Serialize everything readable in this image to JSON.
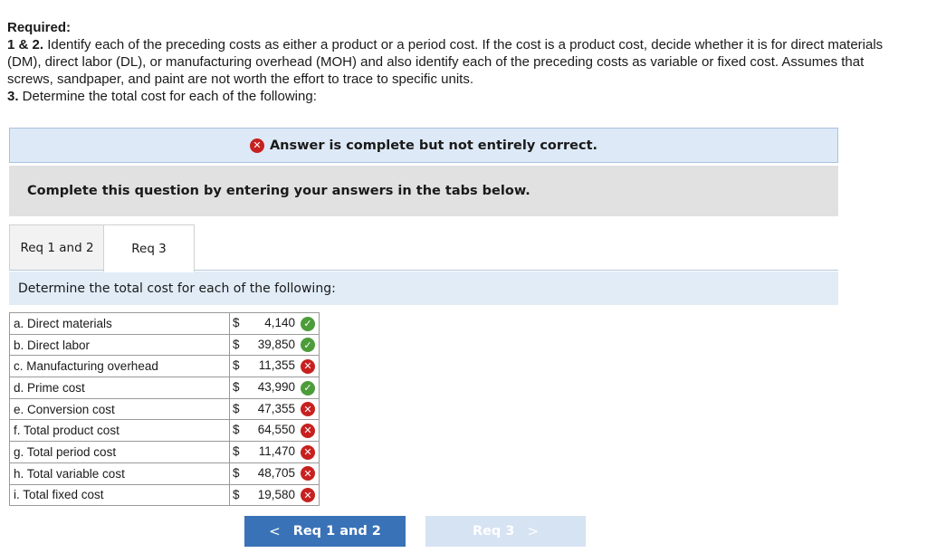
{
  "required": {
    "heading": "Required:",
    "para1_prefix": "1 & 2.",
    "para1_text": " Identify each of the preceding costs as either a product or a period cost. If the cost is a product cost, decide whether it is for direct materials (DM), direct labor (DL), or manufacturing overhead (MOH) and also identify each of the preceding costs as variable or fixed cost. Assumes that screws, sandpaper, and paint are not worth the effort to trace to specific units.",
    "para2_prefix": "3.",
    "para2_text": " Determine the total cost for each of the following:"
  },
  "banner": {
    "text": "Answer is complete but not entirely correct.",
    "icon": "x-icon",
    "color": "#c7211f"
  },
  "instruction": "Complete this question by entering your answers in the tabs below.",
  "tabs": [
    {
      "label": "Req 1 and 2",
      "active": false
    },
    {
      "label": "Req 3",
      "active": true
    }
  ],
  "section_title": "Determine the total cost for each of the following:",
  "rows": [
    {
      "label": "a. Direct materials",
      "currency": "$",
      "value": "4,140",
      "status": "correct"
    },
    {
      "label": "b. Direct labor",
      "currency": "$",
      "value": "39,850",
      "status": "correct"
    },
    {
      "label": "c. Manufacturing overhead",
      "currency": "$",
      "value": "11,355",
      "status": "incorrect"
    },
    {
      "label": "d. Prime cost",
      "currency": "$",
      "value": "43,990",
      "status": "correct"
    },
    {
      "label": "e. Conversion cost",
      "currency": "$",
      "value": "47,355",
      "status": "incorrect"
    },
    {
      "label": "f. Total product cost",
      "currency": "$",
      "value": "64,550",
      "status": "incorrect"
    },
    {
      "label": "g. Total period cost",
      "currency": "$",
      "value": "11,470",
      "status": "incorrect"
    },
    {
      "label": "h. Total variable cost",
      "currency": "$",
      "value": "48,705",
      "status": "incorrect"
    },
    {
      "label": "i. Total fixed cost",
      "currency": "$",
      "value": "19,580",
      "status": "incorrect"
    }
  ],
  "nav": {
    "prev_label": "Req 1 and 2",
    "prev_arrow": "<",
    "next_label": "Req 3",
    "next_arrow": ">"
  },
  "colors": {
    "accent": "#3a72b7",
    "correct": "#4c9c3a",
    "incorrect": "#c7211f"
  }
}
